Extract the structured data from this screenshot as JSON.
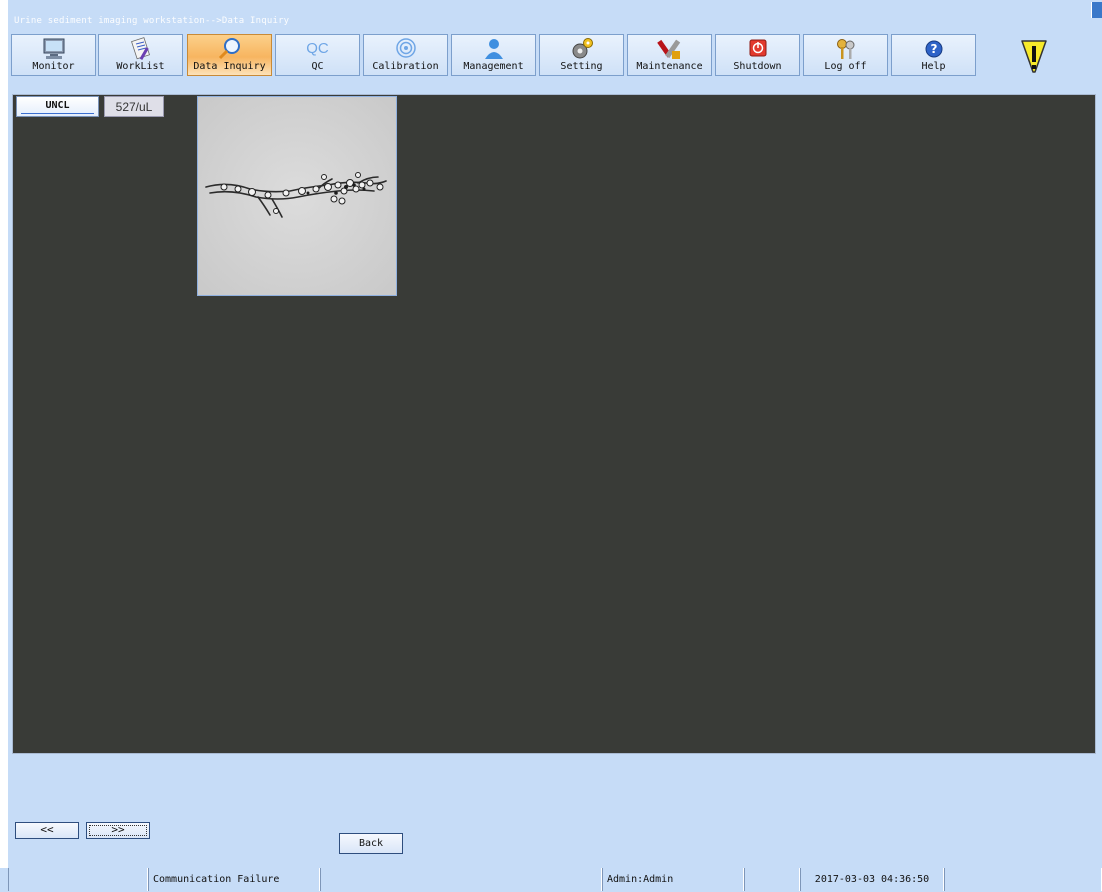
{
  "window": {
    "title": "Urine sediment imaging workstation-->Data Inquiry"
  },
  "toolbar": {
    "buttons": [
      {
        "label": "Monitor",
        "icon": "monitor-icon",
        "active": false
      },
      {
        "label": "WorkList",
        "icon": "worklist-icon",
        "active": false
      },
      {
        "label": "Data Inquiry",
        "icon": "magnifier-icon",
        "active": true
      },
      {
        "label": "QC",
        "icon": "qc-icon",
        "active": false
      },
      {
        "label": "Calibration",
        "icon": "target-icon",
        "active": false
      },
      {
        "label": "Management",
        "icon": "user-icon",
        "active": false
      },
      {
        "label": "Setting",
        "icon": "gear-icon",
        "active": false
      },
      {
        "label": "Maintenance",
        "icon": "tools-icon",
        "active": false
      },
      {
        "label": "Shutdown",
        "icon": "power-icon",
        "active": false
      },
      {
        "label": "Log off",
        "icon": "keys-icon",
        "active": false
      },
      {
        "label": "Help",
        "icon": "help-icon",
        "active": false
      }
    ],
    "qc_icon_text": "QC"
  },
  "panel": {
    "category_tab": "UNCL",
    "count_tab": "527/uL"
  },
  "nav": {
    "prev_label": "<<",
    "next_label": ">>",
    "back_label": "Back"
  },
  "status": {
    "cells": [
      "",
      "Communication Failure",
      "",
      "Admin:Admin",
      "",
      "2017-03-03 04:36:50",
      ""
    ]
  },
  "colors": {
    "background": "#c6dcf7",
    "panel": "#393b37",
    "active_tab": "#f7b560"
  }
}
